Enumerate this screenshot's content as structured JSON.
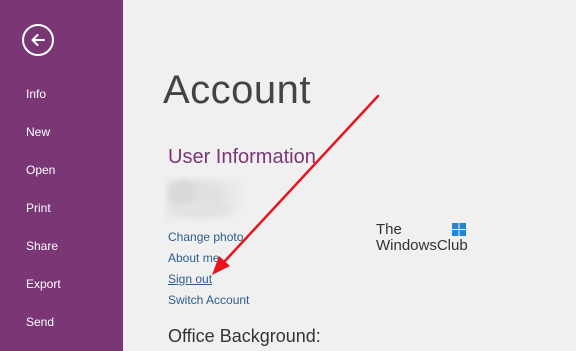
{
  "sidebar": {
    "back_icon": "back-arrow-icon",
    "items": [
      {
        "label": "Info"
      },
      {
        "label": "New"
      },
      {
        "label": "Open"
      },
      {
        "label": "Print"
      },
      {
        "label": "Share"
      },
      {
        "label": "Export"
      },
      {
        "label": "Send"
      }
    ]
  },
  "main": {
    "title": "Account",
    "user_information": {
      "heading": "User Information",
      "links": [
        {
          "label": "Change photo"
        },
        {
          "label": "About me"
        },
        {
          "label": "Sign out"
        },
        {
          "label": "Switch Account"
        }
      ]
    },
    "office_background": {
      "heading": "Office Background:"
    }
  },
  "watermark": {
    "line1": "The",
    "line2": "WindowsClub",
    "logo": "windowsclub-logo-icon"
  },
  "colors": {
    "sidebar": "#7b3775",
    "accent": "#7b3775",
    "link": "#2d5d8a",
    "annotation_arrow": "#e8141c"
  }
}
